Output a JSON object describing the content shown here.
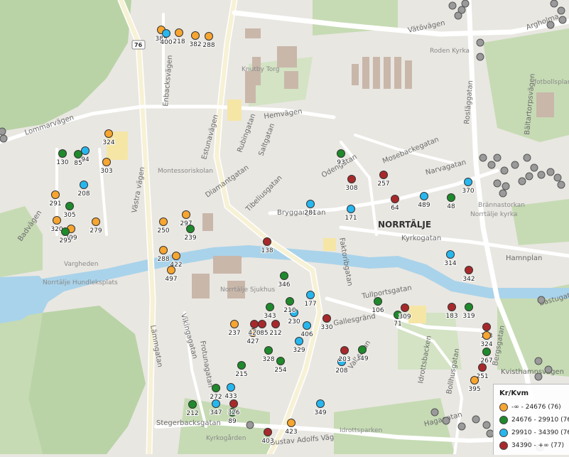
{
  "legend": {
    "title": "Kr/Kvm",
    "items": [
      {
        "label": "-∞ - 24676 (76)",
        "color": "#f7a531"
      },
      {
        "label": "24676 - 29910 (76)",
        "color": "#1f8a2b"
      },
      {
        "label": "29910 - 34390 (76)",
        "color": "#27b7ef"
      },
      {
        "label": "34390 - +∞ (77)",
        "color": "#a8292b"
      }
    ]
  },
  "town_label": "NORRTÄLJE",
  "road_shield": "76",
  "streets": [
    "Vätövägen",
    "Hemvägen",
    "Lommarvägen",
    "Estunavägen",
    "Rubingatan",
    "Saltgatan",
    "Diamantgatan",
    "Tibeliusgatan",
    "Odengatan",
    "Mosebackegatan",
    "Narvagatan",
    "Bryggargatan",
    "Faktoribgatan",
    "Tullportsgatan",
    "Gallesgränd",
    "Vikingagatan",
    "Lämmgatan",
    "Badvägen",
    "Västra vägen",
    "Hamnplan",
    "Kyrkogatan",
    "Bergsgatan",
    "Stegerbacksgatan",
    "Gustav Adolfs Väg",
    "Kvisthamnsvägen",
    "Idrottsbacken",
    "Bastugatan",
    "Rosläggatan",
    "Bältartorpsvägen",
    "Enbacksvägen",
    "Frotunagatan",
    "Vallgatan",
    "Knutby Torg",
    "Montessoriskolan",
    "Vargheden",
    "Norrtälje Hundleksplats",
    "Norrtälje Sjukhus",
    "Roden Kyrka",
    "Norrtälje kyrka",
    "Brännastorkan",
    "fotbollsplan",
    "Idrottsparken",
    "Kyrkogården",
    "Argholma",
    "Hagagatan",
    "Bollhusgatan"
  ],
  "markers": [
    {
      "c": 0,
      "label": "385"
    },
    {
      "c": 2,
      "label": "400"
    },
    {
      "c": 0,
      "label": "218"
    },
    {
      "c": 0,
      "label": "382"
    },
    {
      "c": 0,
      "label": "288"
    },
    {
      "c": 0,
      "label": "324"
    },
    {
      "c": 1,
      "label": "130"
    },
    {
      "c": 1,
      "label": "85"
    },
    {
      "c": 2,
      "label": "94"
    },
    {
      "c": 0,
      "label": "303"
    },
    {
      "c": 2,
      "label": "208"
    },
    {
      "c": 0,
      "label": "291"
    },
    {
      "c": 1,
      "label": "305"
    },
    {
      "c": 0,
      "label": "320"
    },
    {
      "c": 0,
      "label": "299"
    },
    {
      "c": 1,
      "label": "295"
    },
    {
      "c": 0,
      "label": "279"
    },
    {
      "c": 0,
      "label": "250"
    },
    {
      "c": 0,
      "label": "297"
    },
    {
      "c": 1,
      "label": "239"
    },
    {
      "c": 0,
      "label": "288"
    },
    {
      "c": 0,
      "label": "422"
    },
    {
      "c": 0,
      "label": "497"
    },
    {
      "c": 1,
      "label": "93"
    },
    {
      "c": 3,
      "label": "308"
    },
    {
      "c": 3,
      "label": "257"
    },
    {
      "c": 2,
      "label": "281"
    },
    {
      "c": 2,
      "label": "171"
    },
    {
      "c": 3,
      "label": "64"
    },
    {
      "c": 2,
      "label": "489"
    },
    {
      "c": 1,
      "label": "48"
    },
    {
      "c": 2,
      "label": "370"
    },
    {
      "c": 3,
      "label": "138"
    },
    {
      "c": 2,
      "label": "314"
    },
    {
      "c": 3,
      "label": "342"
    },
    {
      "c": 1,
      "label": "106"
    },
    {
      "c": 1,
      "label": "71"
    },
    {
      "c": 3,
      "label": "309"
    },
    {
      "c": 1,
      "label": "319"
    },
    {
      "c": 3,
      "label": "183"
    },
    {
      "c": 3,
      "label": "173"
    },
    {
      "c": 0,
      "label": "324"
    },
    {
      "c": 1,
      "label": "267"
    },
    {
      "c": 3,
      "label": "251"
    },
    {
      "c": 0,
      "label": "395"
    },
    {
      "c": 1,
      "label": "272"
    },
    {
      "c": 2,
      "label": "208"
    },
    {
      "c": 1,
      "label": "254"
    },
    {
      "c": 1,
      "label": "215"
    },
    {
      "c": 2,
      "label": "433"
    },
    {
      "c": 1,
      "label": "212"
    },
    {
      "c": 2,
      "label": "347"
    },
    {
      "c": 0,
      "label": "423"
    },
    {
      "c": 2,
      "label": "349"
    },
    {
      "c": 1,
      "label": "89"
    },
    {
      "c": 3,
      "label": "326"
    },
    {
      "c": 1,
      "label": "346"
    },
    {
      "c": 2,
      "label": "177"
    },
    {
      "c": 2,
      "label": "406"
    },
    {
      "c": 1,
      "label": "343"
    },
    {
      "c": 3,
      "label": "385"
    },
    {
      "c": 2,
      "label": "230"
    },
    {
      "c": 3,
      "label": "212"
    },
    {
      "c": 0,
      "label": "237"
    },
    {
      "c": 0,
      "label": "427"
    },
    {
      "c": 3,
      "label": "420"
    },
    {
      "c": 2,
      "label": "329"
    },
    {
      "c": 1,
      "label": "210"
    },
    {
      "c": 3,
      "label": "330"
    },
    {
      "c": 3,
      "label": "203"
    },
    {
      "c": 1,
      "label": "349"
    },
    {
      "c": 1,
      "label": "328"
    },
    {
      "c": 3,
      "label": "403"
    }
  ]
}
